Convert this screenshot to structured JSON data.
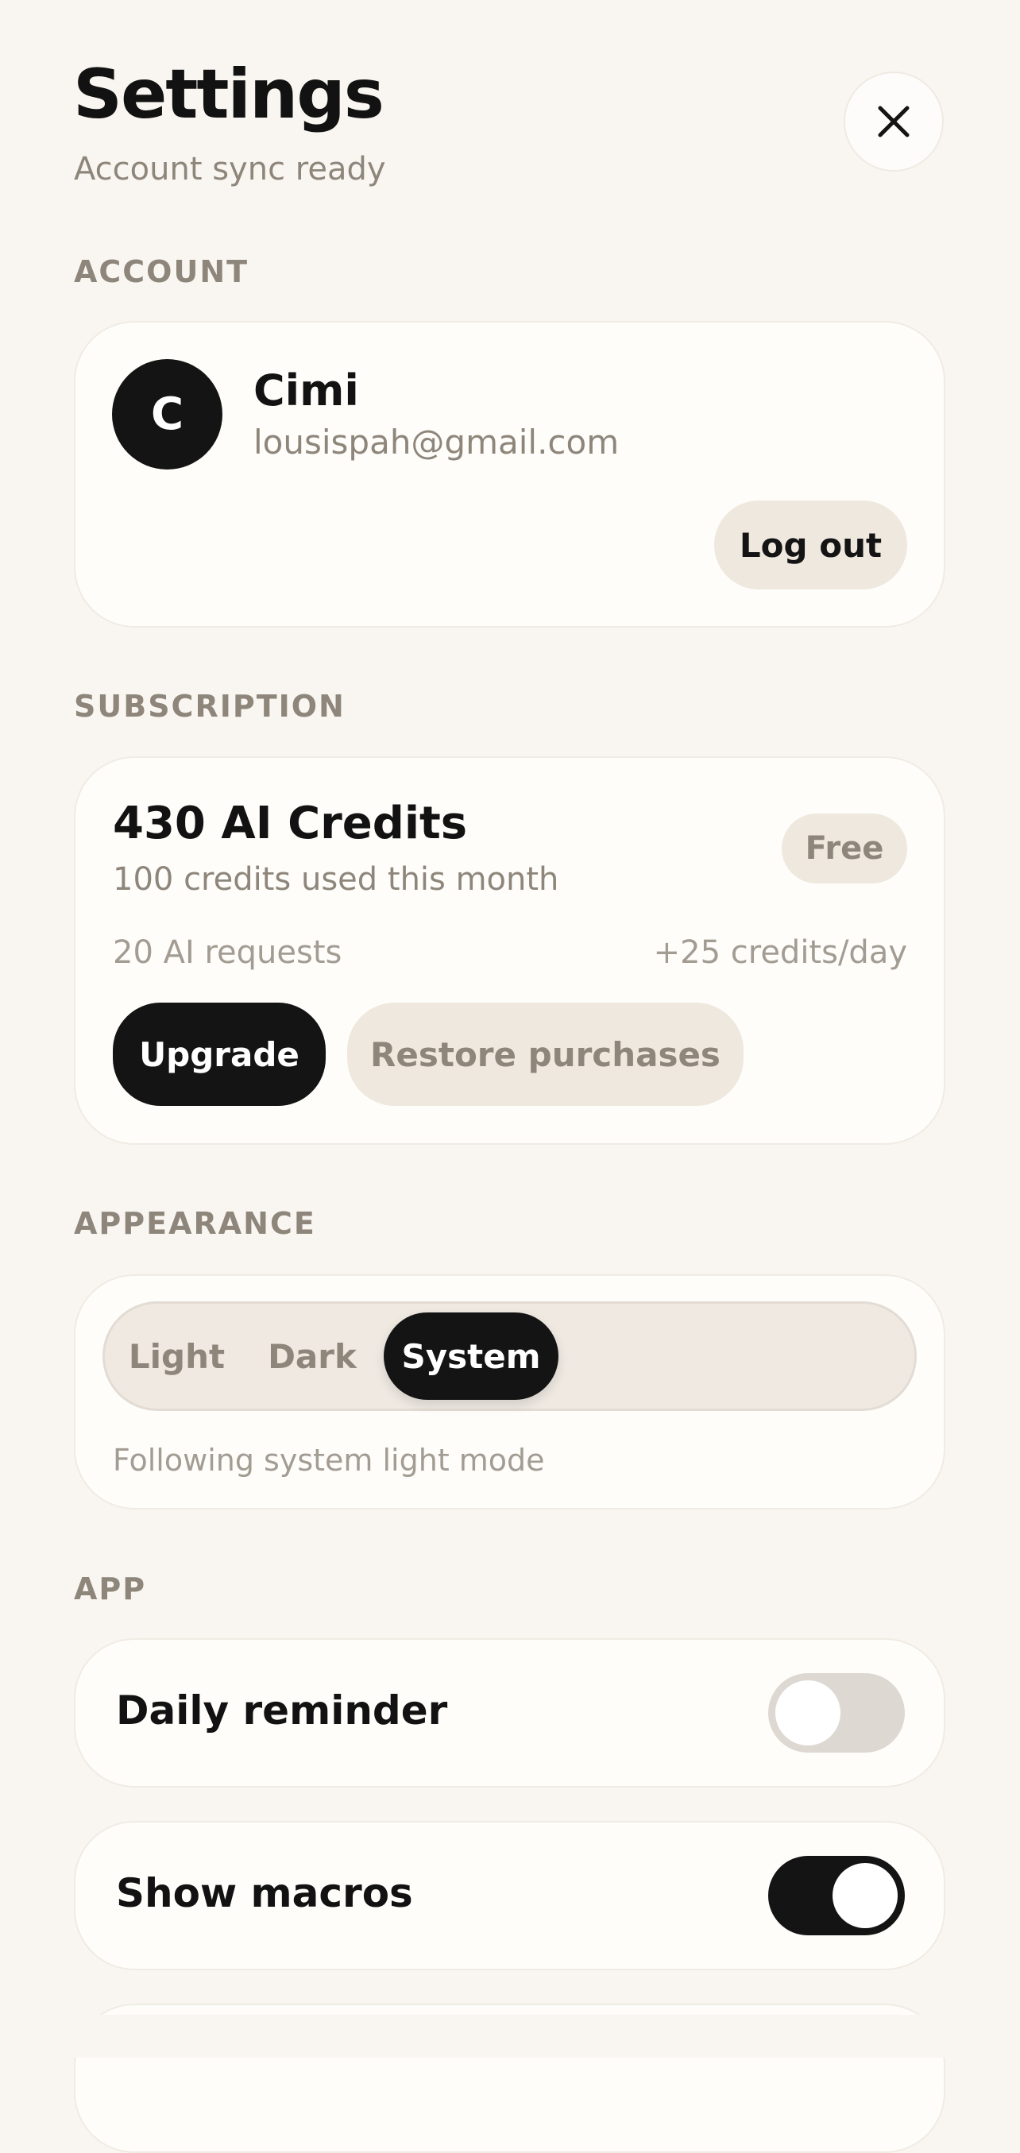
{
  "header": {
    "title": "Settings",
    "subtitle": "Account sync ready",
    "close_icon": "close-icon"
  },
  "account": {
    "section_label": "ACCOUNT",
    "avatar_initial": "C",
    "name": "Cimi",
    "email": "lousispah@gmail.com",
    "logout_label": "Log out"
  },
  "subscription": {
    "section_label": "SUBSCRIPTION",
    "credits_title": "430 AI Credits",
    "credits_used": "100 credits used this month",
    "plan_badge": "Free",
    "requests": "20 AI requests",
    "credits_per_day": "+25 credits/day",
    "upgrade_label": "Upgrade",
    "restore_label": "Restore purchases"
  },
  "appearance": {
    "section_label": "APPEARANCE",
    "options": [
      "Light",
      "Dark",
      "System"
    ],
    "selected": "System",
    "note": "Following system light mode"
  },
  "app": {
    "section_label": "APP",
    "daily_reminder": {
      "label": "Daily reminder",
      "enabled": false
    },
    "show_macros": {
      "label": "Show macros",
      "enabled": true
    }
  },
  "colors": {
    "background": "#f9f6f1",
    "card": "#fefdfa",
    "accent": "#141414",
    "muted_text": "#8e867b",
    "chip": "#efe8df"
  }
}
